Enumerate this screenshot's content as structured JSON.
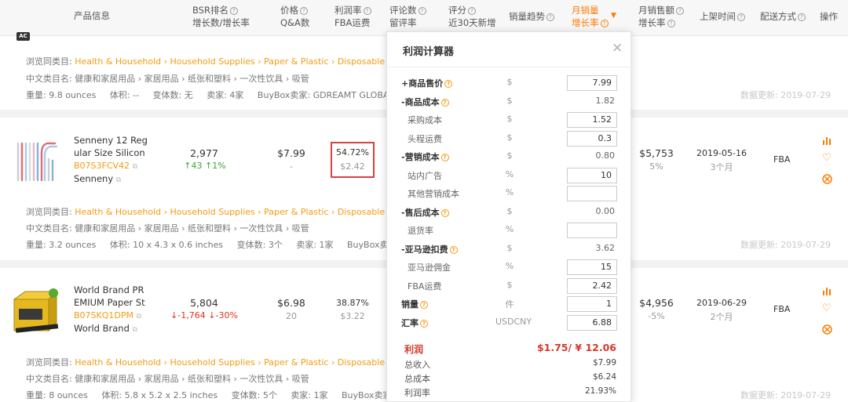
{
  "header": {
    "product_info": "产品信息",
    "bsr_rank": "BSR排名",
    "bsr_growth": "增长数/增长率",
    "price": "价格",
    "qa_count": "Q&A数",
    "profit_rate": "利润率",
    "fba_fee": "FBA运费",
    "review_count": "评论数",
    "leave_rate": "留评率",
    "rating": "评分",
    "new_30d": "近30天新增",
    "sales_trend": "销量趋势",
    "monthly_sales": "月销量",
    "growth_rate": "增长率",
    "monthly_revenue": "月销售额",
    "revenue_growth": "增长率",
    "listing_time": "上架时间",
    "delivery": "配送方式",
    "actions": "操作"
  },
  "badge": "AC",
  "rows": [
    {
      "browse_label": "浏览同类目:",
      "browse_path": "Health & Household › Household Supplies › Paper & Plastic › Disposable Drin",
      "cn_label": "中文类目名:",
      "cn_path": "健康和家居用品 › 家居用品 › 纸张和塑料 › 一次性饮具 › 吸管",
      "weight": "重量: 9.8 ounces",
      "volume": "体积: --",
      "variants": "变体数: 无",
      "sellers": "卖家: 4家",
      "buybox": "BuyBox卖家:  GDREAMT GLOBAL (F",
      "updated": "数据更新: 2019-07-29"
    },
    {
      "name_line1": "Senneny 12 Reg",
      "name_line2": "ular Size Silicon",
      "asin": "B07S3FCV42",
      "brand": "Senneny",
      "bsr": "2,977",
      "bsr_up": "↑43",
      "bsr_pct": "↑1%",
      "price": "$7.99",
      "qa": "-",
      "profit_rate": "54.72%",
      "fba": "$2.42",
      "revenue": "$5,753",
      "revenue_growth": "5%",
      "date": "2019-05-16",
      "age": "3个月",
      "delivery": "FBA",
      "browse_label": "浏览同类目:",
      "browse_path": "Health & Household › Household Supplies › Paper & Plastic › Disposable Drin",
      "cn_label": "中文类目名:",
      "cn_path": "健康和家居用品 › 家居用品 › 纸张和塑料 › 一次性饮具 › 吸管",
      "weight": "重量: 3.2 ounces",
      "volume": "体积: 10 x 4.3 x 0.6 inches",
      "variants": "变体数: 3个",
      "sellers": "卖家: 1家",
      "buybox": "BuyBox卖家:  Se",
      "updated": "数据更新: 2019-07-29"
    },
    {
      "name_line1": "World Brand PR",
      "name_line2": "EMIUM Paper St",
      "asin": "B07SKQ1DPM",
      "brand": "World Brand",
      "bsr": "5,804",
      "bsr_up": "↓-1,764",
      "bsr_pct": "↓-30%",
      "price": "$6.98",
      "qa": "20",
      "profit_rate": "38.87%",
      "fba": "$3.22",
      "revenue": "$4,956",
      "revenue_growth": "-5%",
      "date": "2019-06-29",
      "age": "2个月",
      "delivery": "FBA",
      "browse_label": "浏览同类目:",
      "browse_path": "Health & Household › Household Supplies › Paper & Plastic › Disposable Drin",
      "cn_label": "中文类目名:",
      "cn_path": "健康和家居用品 › 家居用品 › 纸张和塑料 › 一次性饮具 › 吸管",
      "weight": "重量: 8 ounces",
      "volume": "体积: 5.8 x 5.2 x 2.5 inches",
      "variants": "变体数: 5个",
      "sellers": "卖家: 1家",
      "buybox": "BuyBox卖家:  Wo",
      "updated": "数据更新: 2019-07-29"
    }
  ],
  "calc": {
    "title": "利润计算器",
    "close": "×",
    "items": [
      {
        "label": "+商品售价",
        "unit": "$",
        "input": "7.99",
        "qm": true,
        "bold": true
      },
      {
        "label": "-商品成本",
        "unit": "$",
        "value": "1.82",
        "qm": true,
        "bold": true
      },
      {
        "label": "采购成本",
        "unit": "$",
        "input": "1.52",
        "sub": true
      },
      {
        "label": "头程运费",
        "unit": "$",
        "input": "0.3",
        "sub": true
      },
      {
        "label": "-营销成本",
        "unit": "$",
        "value": "0.80",
        "qm": true,
        "bold": true
      },
      {
        "label": "站内广告",
        "unit": "%",
        "input": "10",
        "sub": true
      },
      {
        "label": "其他营销成本",
        "unit": "%",
        "input": "",
        "sub": true
      },
      {
        "label": "-售后成本",
        "unit": "$",
        "value": "0.00",
        "qm": true,
        "bold": true
      },
      {
        "label": "退货率",
        "unit": "%",
        "input": "",
        "sub": true
      },
      {
        "label": "-亚马逊扣费",
        "unit": "$",
        "value": "3.62",
        "qm": true,
        "bold": true
      },
      {
        "label": "亚马逊佣金",
        "unit": "%",
        "input": "15",
        "sub": true
      },
      {
        "label": "FBA运费",
        "unit": "$",
        "input": "2.42",
        "sub": true
      },
      {
        "label": "销量",
        "unit": "件",
        "input": "1",
        "qm": true,
        "bold": true
      },
      {
        "label": "汇率",
        "unit": "USDCNY",
        "input": "6.88",
        "qm": true,
        "bold": true
      }
    ],
    "profit_label": "利润",
    "profit_value": "$1.75/ ¥ 12.06",
    "total_income_label": "总收入",
    "total_income": "$7.99",
    "total_cost_label": "总成本",
    "total_cost": "$6.24",
    "margin_label": "利润率",
    "margin": "21.93%"
  },
  "colors": {
    "accent": "#ff7a00",
    "link": "#f39c12",
    "up": "#3aa53a",
    "down": "#e0301e",
    "highlight": "#d94040"
  }
}
